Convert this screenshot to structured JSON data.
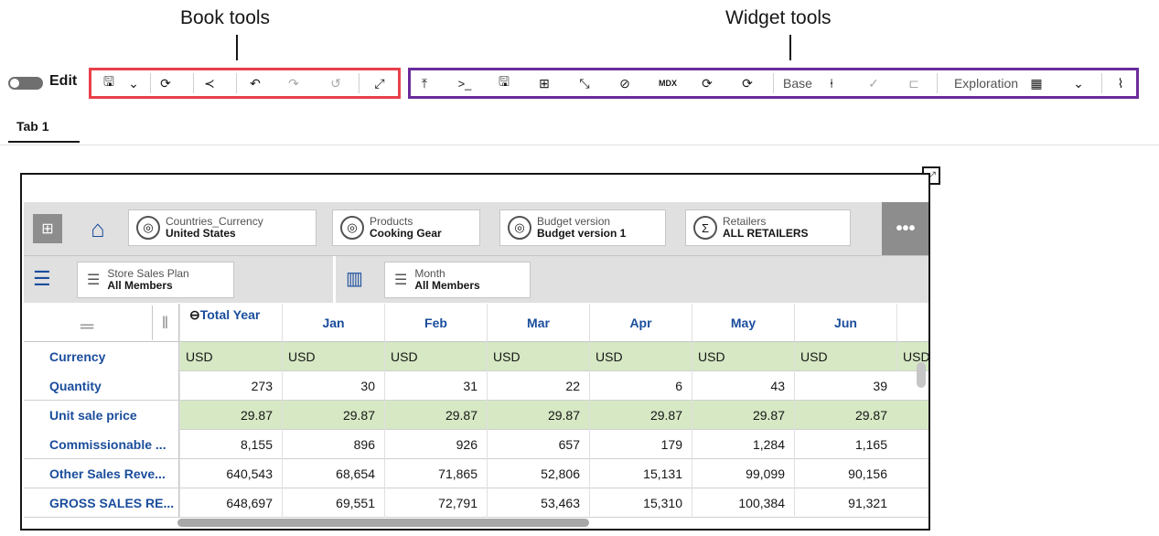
{
  "annotations": {
    "book_tools": "Book tools",
    "widget_tools": "Widget tools"
  },
  "header": {
    "edit_label": "Edit"
  },
  "book_toolbar": [
    {
      "name": "save-icon",
      "glyph": "🖫"
    },
    {
      "name": "chevron-down-icon",
      "glyph": "⌄"
    },
    {
      "name": "refresh-icon",
      "glyph": "⟳"
    },
    {
      "name": "share-icon",
      "glyph": "≺"
    },
    {
      "name": "undo-icon",
      "glyph": "↶"
    },
    {
      "name": "redo-icon",
      "glyph": "↷"
    },
    {
      "name": "reset-icon",
      "glyph": "↺"
    },
    {
      "name": "fullscreen-icon",
      "glyph": "⤢"
    }
  ],
  "widget_toolbar": {
    "base_label": "Base",
    "exploration_label": "Exploration",
    "icons": [
      {
        "name": "pin-top-icon",
        "glyph": "⤒"
      },
      {
        "name": "terminal-icon",
        "glyph": ">_"
      },
      {
        "name": "save-icon",
        "glyph": "🖫"
      },
      {
        "name": "number-format-icon",
        "glyph": "⊞"
      },
      {
        "name": "swap-icon",
        "glyph": "⤡"
      },
      {
        "name": "hide-icon",
        "glyph": "⊘"
      },
      {
        "name": "mdx-icon",
        "glyph": "MDX"
      },
      {
        "name": "sync-icon",
        "glyph": "⟳"
      },
      {
        "name": "sync-settings-icon",
        "glyph": "⟳"
      },
      {
        "name": "sandbox-icon",
        "glyph": "⍿"
      },
      {
        "name": "commit-icon",
        "glyph": "✓"
      },
      {
        "name": "reset-icon",
        "glyph": "⊏"
      },
      {
        "name": "table-icon",
        "glyph": "▦"
      },
      {
        "name": "chevron-down-icon",
        "glyph": "⌄"
      },
      {
        "name": "chart-icon",
        "glyph": "⌇"
      }
    ]
  },
  "tabs": [
    {
      "label": "Tab 1"
    }
  ],
  "context": [
    {
      "dim": "Countries_Currency",
      "member": "United States",
      "icon": "◎"
    },
    {
      "dim": "Products",
      "member": "Cooking Gear",
      "icon": "◎"
    },
    {
      "dim": "Budget version",
      "member": "Budget version 1",
      "icon": "◎"
    },
    {
      "dim": "Retailers",
      "member": "ALL RETAILERS",
      "icon": "Σ"
    }
  ],
  "more_label": "•••",
  "rows_chip": {
    "dim": "Store Sales Plan",
    "member": "All Members"
  },
  "cols_chip": {
    "dim": "Month",
    "member": "All Members"
  },
  "columns": [
    "Total Year",
    "Jan",
    "Feb",
    "Mar",
    "Apr",
    "May",
    "Jun"
  ],
  "truncated_col_value": "USD",
  "rows": [
    {
      "label": "Currency",
      "values": [
        "USD",
        "USD",
        "USD",
        "USD",
        "USD",
        "USD",
        "USD"
      ],
      "green": true
    },
    {
      "label": "Quantity",
      "values": [
        "273",
        "30",
        "31",
        "22",
        "6",
        "43",
        "39"
      ],
      "green": false
    },
    {
      "label": "Unit sale price",
      "values": [
        "29.87",
        "29.87",
        "29.87",
        "29.87",
        "29.87",
        "29.87",
        "29.87"
      ],
      "green": true
    },
    {
      "label": "Commissionable ...",
      "values": [
        "8,155",
        "896",
        "926",
        "657",
        "179",
        "1,284",
        "1,165"
      ],
      "green": false
    },
    {
      "label": "Other Sales Reve...",
      "values": [
        "640,543",
        "68,654",
        "71,865",
        "52,806",
        "15,131",
        "99,099",
        "90,156"
      ],
      "green": false
    },
    {
      "label": "GROSS SALES RE...",
      "values": [
        "648,697",
        "69,551",
        "72,791",
        "53,463",
        "15,310",
        "100,384",
        "91,321"
      ],
      "green": false
    }
  ],
  "colors": {
    "green_row": "#d6e8c4",
    "red_box": "#e8404a",
    "purple_box": "#6a2b9c",
    "link_text": "#1a4d9c"
  }
}
